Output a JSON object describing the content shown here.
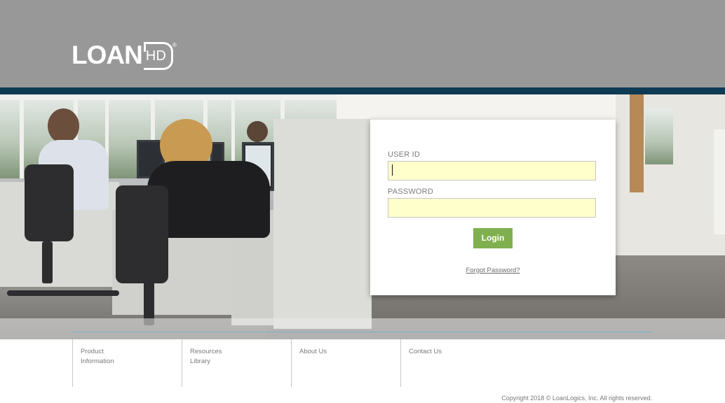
{
  "header": {
    "logo_main": "LOAN",
    "logo_box": "HD",
    "logo_mark": "®"
  },
  "login": {
    "user_id_label": "USER ID",
    "user_id_value": "",
    "password_label": "PASSWORD",
    "password_value": "",
    "login_button": "Login",
    "forgot_link": "Forgot Password?"
  },
  "footer": {
    "links": [
      {
        "label": "Product Information"
      },
      {
        "label": "Resources Library"
      },
      {
        "label": "About Us"
      },
      {
        "label": "Contact Us"
      }
    ],
    "copyright": "Copyright 2018 © LoanLogics, Inc. All rights reserved."
  },
  "colors": {
    "header_bg": "#989898",
    "accent_bar": "#0f3a54",
    "login_button": "#7faf4e",
    "input_fill": "#ffffcc"
  }
}
